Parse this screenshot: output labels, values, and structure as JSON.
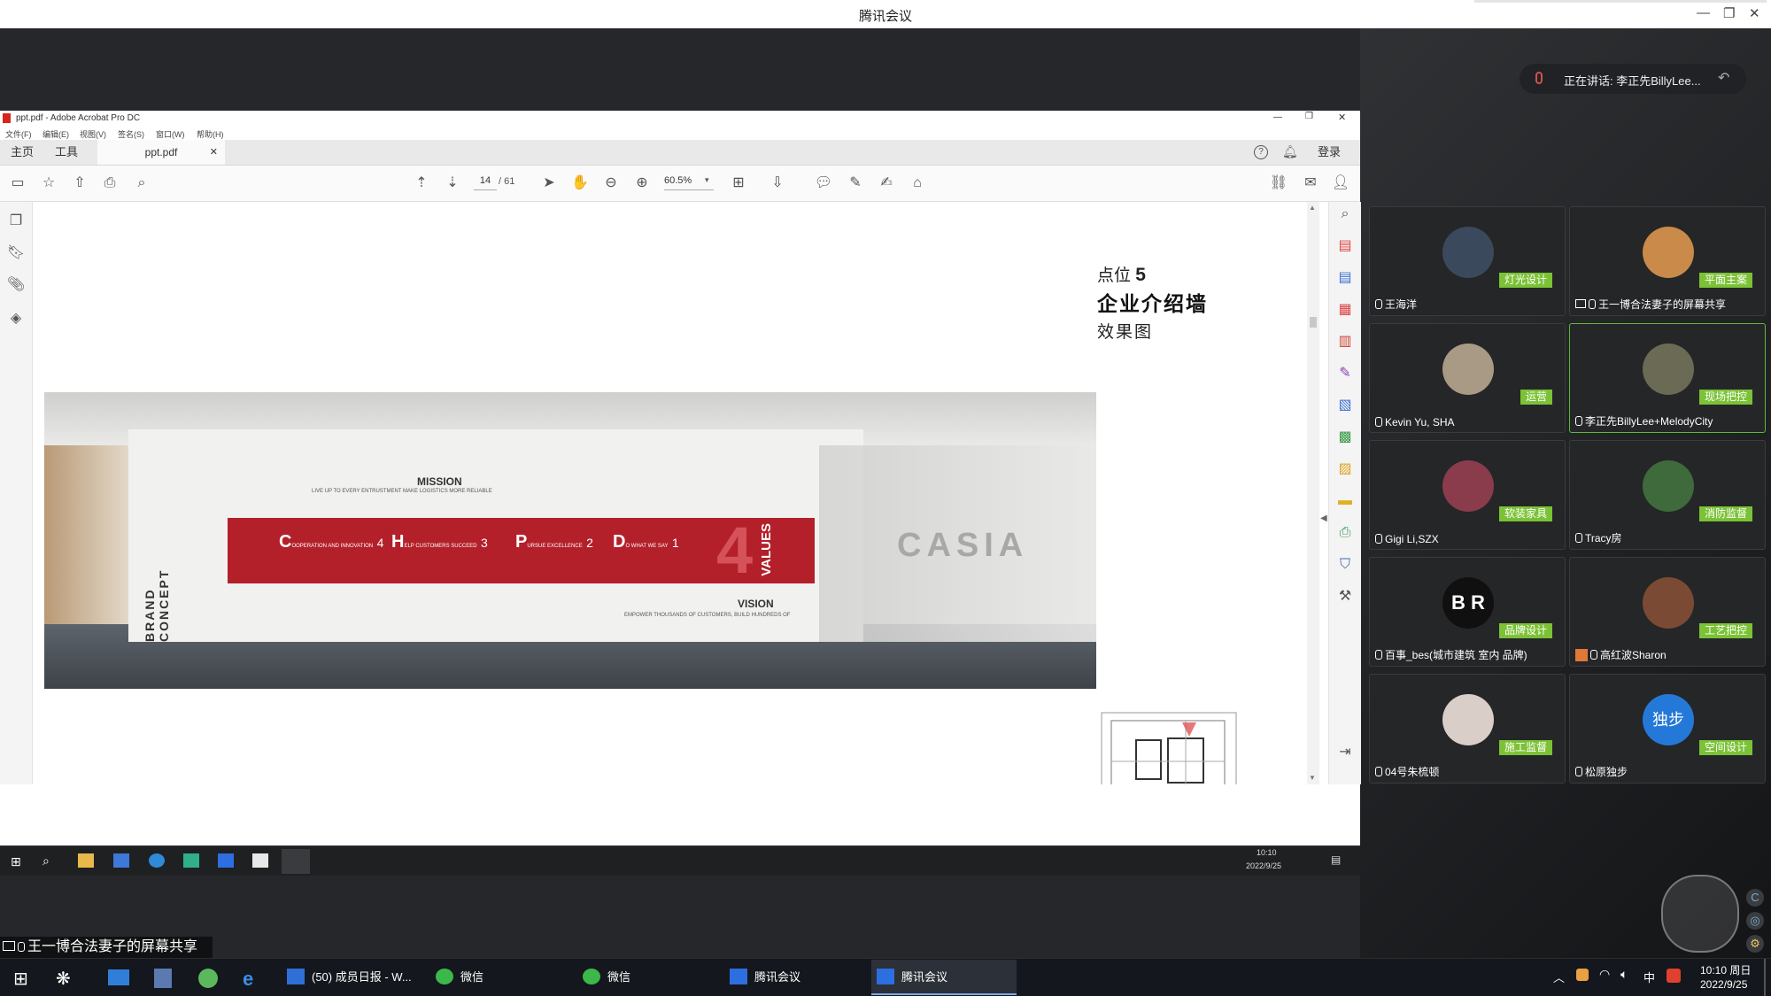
{
  "tencent_meeting": {
    "title": "腾讯会议",
    "speaking": "正在讲话: 李正先BillyLee...",
    "share_banner": "王一博合法妻子的屏幕共享"
  },
  "acrobat": {
    "title": "ppt.pdf - Adobe Acrobat Pro DC",
    "menu": [
      "文件(F)",
      "编辑(E)",
      "视图(V)",
      "签名(S)",
      "窗口(W)",
      "帮助(H)"
    ],
    "tabs": {
      "home": "主页",
      "tools": "工具",
      "file": "ppt.pdf",
      "login": "登录"
    },
    "page_current": "14",
    "page_total": "/ 61",
    "zoom": "60.5%"
  },
  "slide": {
    "point_label": "点位",
    "point_number": "5",
    "heading": "企业介绍墙",
    "subheading": "效果图",
    "wall": {
      "brand_concept": "BRAND CONCEPT",
      "mission": "MISSION",
      "mission_sub": "LIVE UP TO EVERY ENTRUSTMENT MAKE LOGISTICS MORE RELIABLE",
      "values_number": "4",
      "values_word": "VALUES",
      "vision": "VISION",
      "vision_sub": "EMPOWER THOUSANDS OF CUSTOMERS, BUILD HUNDREDS OF",
      "logo": "CASIA",
      "values": [
        {
          "initial": "C",
          "text": "OOPERATION AND INNOVATION",
          "n": "4"
        },
        {
          "initial": "H",
          "text": "ELP CUSTOMERS SUCCEED",
          "n": "3"
        },
        {
          "initial": "P",
          "text": "URSUE EXCELLENCE",
          "n": "2"
        },
        {
          "initial": "D",
          "text": "O WHAT WE SAY",
          "n": "1"
        }
      ]
    }
  },
  "inner_taskbar": {
    "time": "10:10",
    "date": "2022/9/25"
  },
  "participants": [
    {
      "name": "王海洋",
      "role": "灯光设计",
      "avatar_color": "#3a4a5c"
    },
    {
      "name": "王一博合法妻子的屏幕共享",
      "role": "平面主案",
      "avatar_color": "#c98a4a"
    },
    {
      "name": "Kevin Yu, SHA",
      "role": "运营",
      "avatar_color": "#a89a84"
    },
    {
      "name": "李正先BillyLee+MelodyCity",
      "role": "现场把控",
      "avatar_color": "#6b6a55"
    },
    {
      "name": "Gigi Li,SZX",
      "role": "软装家具",
      "avatar_color": "#8a3c4c"
    },
    {
      "name": "Tracy房",
      "role": "消防监督",
      "avatar_color": "#3f6a3b"
    },
    {
      "name": "百事_bes(城市建筑 室内 品牌)",
      "role": "品牌设计",
      "avatar_text": "B R",
      "avatar_color": "#101010"
    },
    {
      "name": "高红波Sharon",
      "role": "工艺把控",
      "avatar_color": "#7a4a35"
    },
    {
      "name": "04号朱梳顿",
      "role": "施工监督",
      "avatar_color": "#d9cfc8"
    },
    {
      "name": "松原独步",
      "role": "空间设计",
      "avatar_text": "独步",
      "avatar_color": "#2479d8"
    }
  ],
  "taskbar": {
    "apps": [
      "(50) 成员日报 - W...",
      "微信",
      "微信",
      "腾讯会议",
      "腾讯会议"
    ],
    "time": "10:10 周日",
    "date": "2022/9/25",
    "ime": "中"
  },
  "colors": {
    "role_badge": "#7bc236",
    "wall_red": "#b3202a",
    "meeting_dark": "#25272b"
  }
}
